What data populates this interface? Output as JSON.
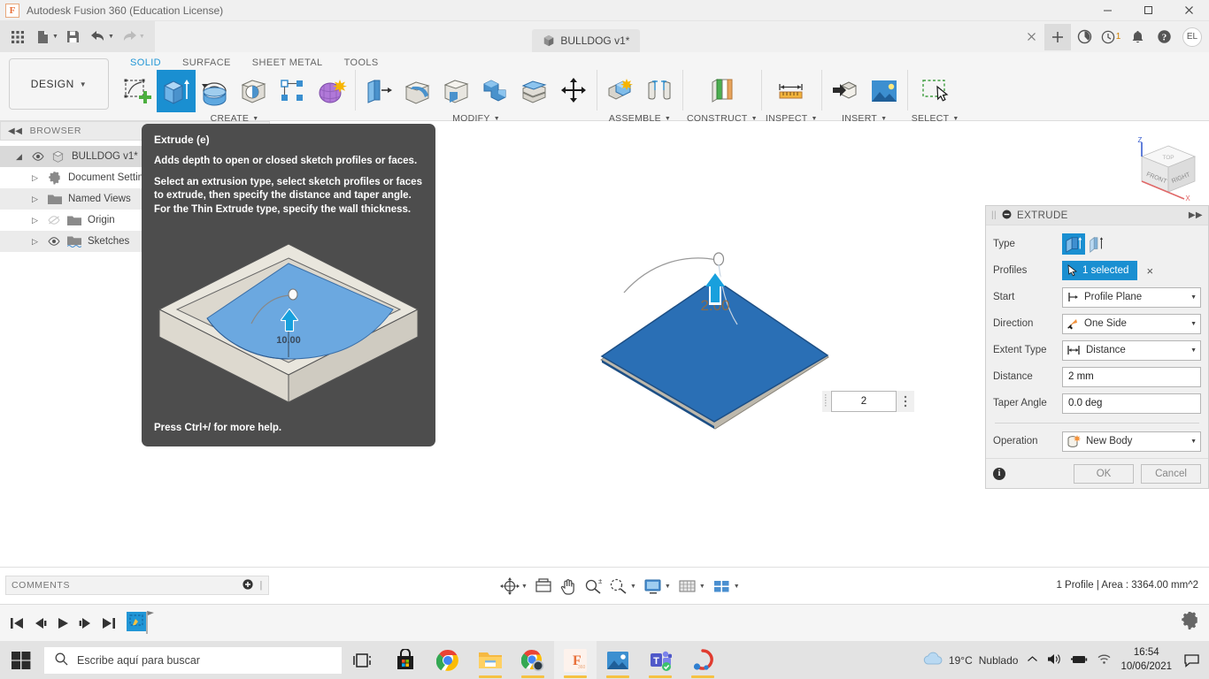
{
  "window": {
    "app_title": "Autodesk Fusion 360 (Education License)",
    "app_icon": "F",
    "minimize_icon": "minimize-icon",
    "maximize_icon": "maximize-icon",
    "close_icon": "close-icon"
  },
  "quick_access": {
    "grid_icon": "app-grid-icon",
    "new_icon": "new-document-icon",
    "save_icon": "save-icon",
    "undo_icon": "undo-icon",
    "redo_icon": "redo-icon",
    "document_tab": "BULLDOG v1*",
    "tab_close_label": "×",
    "new_tab_label": "+",
    "help_badge": "1",
    "avatar_initials": "EL"
  },
  "ribbon": {
    "design_label": "DESIGN",
    "tabs": [
      {
        "label": "SOLID",
        "active": true
      },
      {
        "label": "SURFACE",
        "active": false
      },
      {
        "label": "SHEET METAL",
        "active": false
      },
      {
        "label": "TOOLS",
        "active": false
      }
    ],
    "groups": [
      {
        "label": "CREATE",
        "has_caret": true,
        "items": [
          {
            "name": "new-sketch-tool",
            "selected": false
          },
          {
            "name": "extrude-tool",
            "selected": true
          },
          {
            "name": "revolve-tool",
            "selected": false
          },
          {
            "name": "hole-tool",
            "selected": false
          },
          {
            "name": "rectangular-pattern-tool",
            "selected": false
          },
          {
            "name": "create-form-tool",
            "selected": false
          }
        ]
      },
      {
        "label": "MODIFY",
        "has_caret": true,
        "items": [
          {
            "name": "press-pull-tool",
            "selected": false
          },
          {
            "name": "fillet-tool",
            "selected": false
          },
          {
            "name": "shell-tool",
            "selected": false
          },
          {
            "name": "combine-tool",
            "selected": false
          },
          {
            "name": "split-face-tool",
            "selected": false
          },
          {
            "name": "move-copy-tool",
            "selected": false
          }
        ]
      },
      {
        "label": "ASSEMBLE",
        "has_caret": true,
        "items": [
          {
            "name": "new-component-tool",
            "selected": false
          },
          {
            "name": "joint-tool",
            "selected": false
          }
        ]
      },
      {
        "label": "CONSTRUCT",
        "has_caret": true,
        "items": [
          {
            "name": "offset-plane-tool",
            "selected": false
          }
        ]
      },
      {
        "label": "INSPECT",
        "has_caret": true,
        "items": [
          {
            "name": "measure-tool",
            "selected": false
          }
        ]
      },
      {
        "label": "INSERT",
        "has_caret": true,
        "items": [
          {
            "name": "insert-derive-tool",
            "selected": false
          },
          {
            "name": "canvas-tool",
            "selected": false
          }
        ]
      },
      {
        "label": "SELECT",
        "has_caret": true,
        "items": [
          {
            "name": "select-tool",
            "selected": false
          }
        ]
      }
    ]
  },
  "browser": {
    "header": "BROWSER",
    "collapse_icon": "collapse-left-icon",
    "items": [
      {
        "label": "BULLDOG v1*",
        "icon": "body-cube-icon",
        "visible": true,
        "root": true
      },
      {
        "label": "Document Settings",
        "icon": "gear-icon",
        "visible": false
      },
      {
        "label": "Named Views",
        "icon": "folder-icon",
        "visible": false
      },
      {
        "label": "Origin",
        "icon": "folder-icon",
        "visible": false,
        "hidden_eye": true
      },
      {
        "label": "Sketches",
        "icon": "sketch-folder-icon",
        "visible": true
      }
    ]
  },
  "tooltip": {
    "title": "Extrude (e)",
    "para1": "Adds depth to open or closed sketch profiles or faces.",
    "para2": "Select an extrusion type, select sketch profiles or faces to extrude, then specify the distance and taper angle. For the Thin Extrude type, specify the wall thickness.",
    "footer": "Press Ctrl+/ for more help.",
    "image_label": "10.00"
  },
  "viewport": {
    "viewcube": {
      "front_label": "FRONT",
      "right_label": "RIGHT",
      "top_label": "TOP",
      "axis_z": "Z",
      "axis_x": "X"
    },
    "manipulator_value": "2",
    "dimension_label": "2.00"
  },
  "extrude_dialog": {
    "title": "EXTRUDE",
    "collapse_icon": "minus-circle-icon",
    "expand_icon": "expand-right-icon",
    "fields": {
      "type_label": "Type",
      "type_options": [
        "solid-extrude",
        "thin-extrude"
      ],
      "type_selected_index": 0,
      "profiles_label": "Profiles",
      "profiles_value": "1 selected",
      "profiles_clear": "×",
      "start_label": "Start",
      "start_value": "Profile Plane",
      "direction_label": "Direction",
      "direction_value": "One Side",
      "extent_type_label": "Extent Type",
      "extent_type_value": "Distance",
      "distance_label": "Distance",
      "distance_value": "2 mm",
      "taper_angle_label": "Taper Angle",
      "taper_angle_value": "0.0 deg",
      "operation_label": "Operation",
      "operation_value": "New Body"
    },
    "ok_label": "OK",
    "cancel_label": "Cancel",
    "info_icon": "info-icon"
  },
  "status_bar": {
    "comments_label": "COMMENTS",
    "comments_add": "+",
    "status_text": "1 Profile | Area : 3364.00 mm^2",
    "nav_items": [
      {
        "name": "orbit-icon",
        "caret": true
      },
      {
        "name": "look-at-icon",
        "caret": false
      },
      {
        "name": "pan-hand-icon",
        "caret": false
      },
      {
        "name": "zoom-icon",
        "caret": false
      },
      {
        "name": "zoom-window-icon",
        "caret": true
      },
      {
        "name": "display-settings-icon",
        "caret": true
      },
      {
        "name": "grid-snaps-icon",
        "caret": true
      },
      {
        "name": "viewports-icon",
        "caret": true
      }
    ]
  },
  "timeline": {
    "buttons": [
      {
        "name": "go-to-beginning-icon"
      },
      {
        "name": "step-back-icon"
      },
      {
        "name": "play-icon"
      },
      {
        "name": "step-forward-icon"
      },
      {
        "name": "go-to-end-icon"
      }
    ],
    "feature_icon": "sketch-feature-icon",
    "settings_icon": "gear-icon"
  },
  "taskbar": {
    "start_icon": "windows-start-icon",
    "search_placeholder": "Escribe aquí para buscar",
    "search_icon": "search-icon",
    "apps": [
      {
        "name": "task-view-icon",
        "running": false
      },
      {
        "name": "microsoft-store-icon",
        "running": false
      },
      {
        "name": "google-chrome-icon",
        "running": false
      },
      {
        "name": "file-explorer-icon",
        "running": true
      },
      {
        "name": "chrome-window-icon",
        "running": true
      },
      {
        "name": "fusion-360-icon",
        "running": true,
        "active": true
      },
      {
        "name": "photos-icon",
        "running": true
      },
      {
        "name": "microsoft-teams-icon",
        "running": true
      },
      {
        "name": "screen-recorder-icon",
        "running": true
      }
    ],
    "tray": {
      "weather_icon": "cloud-icon",
      "temperature": "19°C",
      "weather_text": "Nublado",
      "chevron_icon": "chevron-up-icon",
      "volume_icon": "volume-icon",
      "battery_icon": "battery-icon",
      "wifi_icon": "wifi-icon",
      "time": "16:54",
      "date": "10/06/2021",
      "action_center_icon": "action-center-icon"
    }
  }
}
